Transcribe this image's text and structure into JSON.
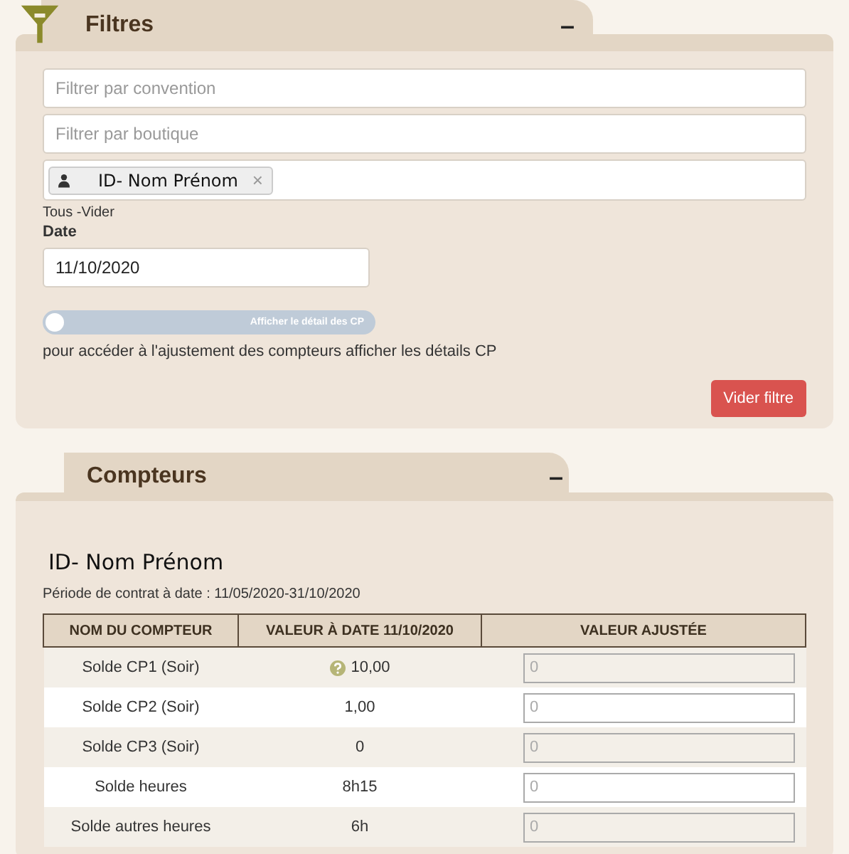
{
  "filters": {
    "title": "Filtres",
    "collapse": "–",
    "fields": [
      {
        "placeholder": "Filtrer par convention"
      },
      {
        "placeholder": "Filtrer par boutique"
      }
    ],
    "person_tag": {
      "label": "ID- Nom Prénom",
      "remove": "×"
    },
    "tag_links": "Tous -Vider",
    "date_label": "Date",
    "date_value": "11/10/2020",
    "toggle": {
      "label": "Afficher le détail des CP",
      "on": false
    },
    "hint": "pour accéder à l'ajustement des compteurs afficher les détails CP",
    "clear_button": "Vider filtre"
  },
  "counters": {
    "title": "Compteurs",
    "collapse": "–",
    "person": "ID- Nom Prénom",
    "period": "Période de contrat à date : 11/05/2020-31/10/2020",
    "columns": [
      "NOM DU COMPTEUR",
      "VALEUR À DATE 11/10/2020",
      "VALEUR AJUSTÉE"
    ],
    "rows": [
      {
        "name": "Solde CP1 (Soir)",
        "value": "10,00",
        "help": true,
        "placeholder": "0"
      },
      {
        "name": "Solde CP2 (Soir)",
        "value": "1,00",
        "help": false,
        "placeholder": "0"
      },
      {
        "name": "Solde CP3 (Soir)",
        "value": "0",
        "help": false,
        "placeholder": "0"
      },
      {
        "name": "Solde heures",
        "value": "8h15",
        "help": false,
        "placeholder": "0"
      },
      {
        "name": "Solde autres heures",
        "value": "6h",
        "help": false,
        "placeholder": "0"
      }
    ]
  }
}
